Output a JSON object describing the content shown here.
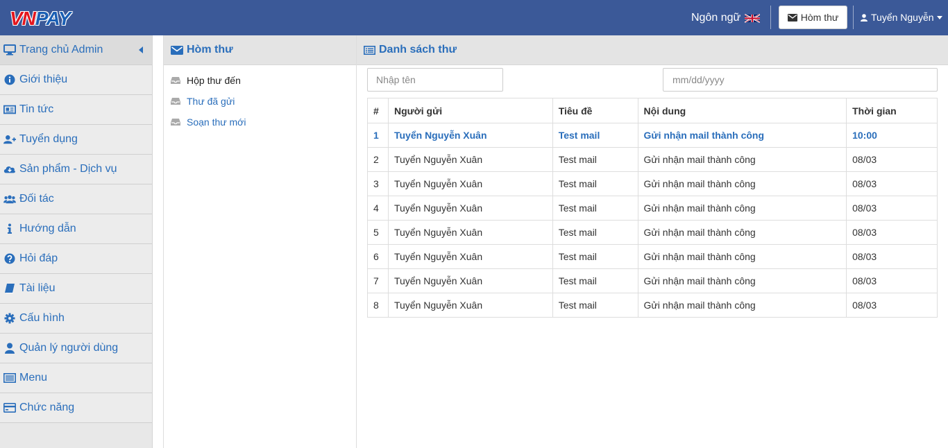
{
  "header": {
    "logo": {
      "part1": "VN",
      "part2": "PAY"
    },
    "language_label": "Ngôn ngữ",
    "inbox_button": "Hòm thư",
    "user_name": "Tuyển Nguyễn"
  },
  "sidebar": {
    "items": [
      {
        "label": "Trang chủ Admin",
        "icon": "monitor-icon"
      },
      {
        "label": "Giới thiệu",
        "icon": "info-circle-icon"
      },
      {
        "label": "Tin tức",
        "icon": "newspaper-icon"
      },
      {
        "label": "Tuyển dụng",
        "icon": "user-plus-icon"
      },
      {
        "label": "Sản phẩm - Dịch vụ",
        "icon": "cloud-download-icon"
      },
      {
        "label": "Đối tác",
        "icon": "users-icon"
      },
      {
        "label": "Hướng dẫn",
        "icon": "info-icon"
      },
      {
        "label": "Hỏi đáp",
        "icon": "question-circle-icon"
      },
      {
        "label": "Tài liệu",
        "icon": "book-icon"
      },
      {
        "label": "Cấu hình",
        "icon": "gear-icon"
      },
      {
        "label": "Quản lý người dùng",
        "icon": "user-icon"
      },
      {
        "label": "Menu",
        "icon": "list-icon"
      },
      {
        "label": "Chức năng",
        "icon": "credit-card-icon"
      }
    ]
  },
  "mailbox": {
    "title": "Hòm thư",
    "folders": [
      {
        "label": "Hộp thư đến"
      },
      {
        "label": "Thư đã gửi"
      },
      {
        "label": "Soạn thư mới"
      }
    ]
  },
  "mail_list": {
    "title": "Danh sách thư",
    "search_placeholder": "Nhập tên",
    "date_placeholder": "mm/dd/yyyy",
    "columns": {
      "num": "#",
      "sender": "Người gửi",
      "subject": "Tiêu đề",
      "content": "Nội dung",
      "time": "Thời gian"
    },
    "rows": [
      {
        "num": "1",
        "sender": "Tuyển Nguyễn Xuân",
        "subject": "Test mail",
        "content": "Gửi nhận mail thành công",
        "time": "10:00"
      },
      {
        "num": "2",
        "sender": "Tuyển Nguyễn Xuân",
        "subject": "Test mail",
        "content": "Gửi nhận mail thành công",
        "time": "08/03"
      },
      {
        "num": "3",
        "sender": "Tuyển Nguyễn Xuân",
        "subject": "Test mail",
        "content": "Gửi nhận mail thành công",
        "time": "08/03"
      },
      {
        "num": "4",
        "sender": "Tuyển Nguyễn Xuân",
        "subject": "Test mail",
        "content": "Gửi nhận mail thành công",
        "time": "08/03"
      },
      {
        "num": "5",
        "sender": "Tuyển Nguyễn Xuân",
        "subject": "Test mail",
        "content": "Gửi nhận mail thành công",
        "time": "08/03"
      },
      {
        "num": "6",
        "sender": "Tuyển Nguyễn Xuân",
        "subject": "Test mail",
        "content": "Gửi nhận mail thành công",
        "time": "08/03"
      },
      {
        "num": "7",
        "sender": "Tuyển Nguyễn Xuân",
        "subject": "Test mail",
        "content": "Gửi nhận mail thành công",
        "time": "08/03"
      },
      {
        "num": "8",
        "sender": "Tuyển Nguyễn Xuân",
        "subject": "Test mail",
        "content": "Gửi nhận mail thành công",
        "time": "08/03"
      }
    ]
  },
  "colors": {
    "header_bg": "#3b5998",
    "link": "#2a6ebb",
    "sidebar_bg": "#ececec"
  }
}
